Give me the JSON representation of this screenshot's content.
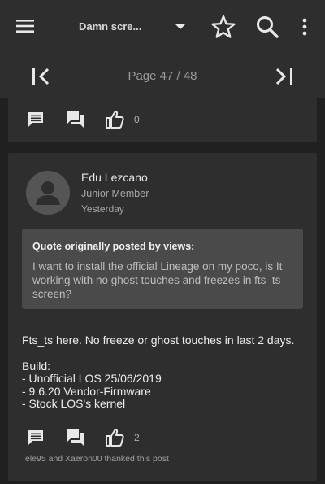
{
  "appbar": {
    "title": "Damn scre...",
    "icons": [
      "menu-icon",
      "dropdown-arrow-icon",
      "star-icon",
      "search-icon",
      "more-vert-icon"
    ]
  },
  "pager": {
    "page_label": "Page 47 / 48",
    "icons": [
      "first-page-icon",
      "last-page-icon"
    ]
  },
  "previous_post": {
    "like_count": "0"
  },
  "post": {
    "author": "Edu Lezcano",
    "role": "Junior Member",
    "time": "Yesterday",
    "quote": {
      "heading": "Quote originally posted by views:",
      "text": "I want to install the official Lineage on my poco, is It working with no ghost touches and freezes in fts_ts screen?"
    },
    "body": {
      "line1": "Fts_ts here. No freeze or ghost touches in last 2 days.",
      "line2": "Build:",
      "line3": "- Unofficial LOS 25/06/2019",
      "line4": "- 9.6.20 Vendor-Firmware",
      "line5": "- Stock LOS's kernel"
    },
    "like_count": "2",
    "thanks": "ele95 and Xaeron00 thanked this post"
  },
  "colors": {
    "background": "#202020",
    "surface": "#2e2e2e",
    "quote_bg": "#4a4a4a",
    "icon": "#e8e8e8"
  }
}
